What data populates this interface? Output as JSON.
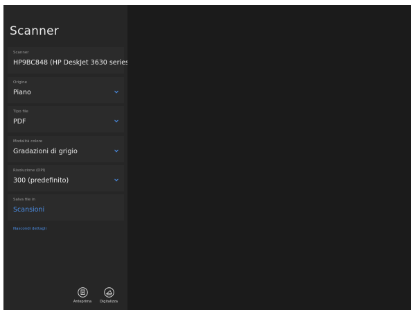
{
  "app": {
    "title": "Scanner"
  },
  "fields": [
    {
      "label": "Scanner",
      "value": "HP9BC848 (HP DeskJet 3630 series)",
      "dropdown": false,
      "link": false
    },
    {
      "label": "Origine",
      "value": "Piano",
      "dropdown": true,
      "link": false
    },
    {
      "label": "Tipo file",
      "value": "PDF",
      "dropdown": true,
      "link": false
    },
    {
      "label": "Modalità colore",
      "value": "Gradazioni di grigio",
      "dropdown": true,
      "link": false
    },
    {
      "label": "Risoluzione (DPI)",
      "value": "300 (predefinito)",
      "dropdown": true,
      "link": false
    },
    {
      "label": "Salva file in",
      "value": "Scansioni",
      "dropdown": false,
      "link": true
    }
  ],
  "details_link": "Nascondi dettagli",
  "actions": {
    "preview": {
      "label": "Anteprima",
      "icon": "preview-icon"
    },
    "scan": {
      "label": "Digitalizza",
      "icon": "scan-icon"
    }
  },
  "colors": {
    "accent": "#4b8ee6",
    "sidebar_bg": "#262626",
    "field_bg": "#2b2b2b",
    "preview_bg": "#1b1b1b"
  }
}
